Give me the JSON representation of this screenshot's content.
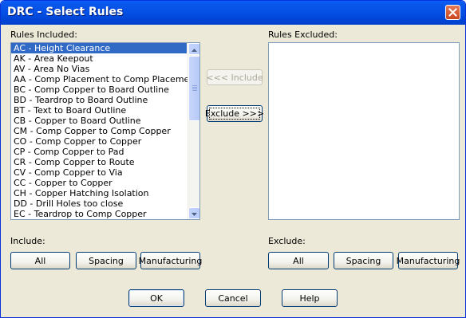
{
  "window": {
    "title": "DRC - Select Rules"
  },
  "included": {
    "label": "Rules Included:",
    "items": [
      "AC - Height Clearance",
      "AK - Area Keepout",
      "AV - Area No Vias",
      "AA - Comp Placement to Comp Placement",
      "BC - Comp Copper to Board Outline",
      "BD - Teardrop to Board Outline",
      "BT - Text to Board Outline",
      "CB - Copper to Board Outline",
      "CM - Comp Copper to Comp Copper",
      "CO - Comp Copper to Copper",
      "CP - Comp Copper to Pad",
      "CR - Comp Copper to Route",
      "CV - Comp Copper to Via",
      "CC - Copper to Copper",
      "CH - Copper Hatching Isolation",
      "DD - Drill Holes too close",
      "EC - Teardrop to Comp Copper"
    ],
    "selected_index": 0
  },
  "excluded": {
    "label": "Rules Excluded:",
    "items": []
  },
  "middle": {
    "include_label": "<<< Include",
    "exclude_label": "Exclude >>>"
  },
  "include_group": {
    "label": "Include:",
    "all": "All",
    "spacing": "Spacing",
    "manufacturing": "Manufacturing"
  },
  "exclude_group": {
    "label": "Exclude:",
    "all": "All",
    "spacing": "Spacing",
    "manufacturing": "Manufacturing"
  },
  "footer": {
    "ok": "OK",
    "cancel": "Cancel",
    "help": "Help"
  },
  "colors": {
    "title_bar": "#0550e6",
    "selection": "#316ac5",
    "dialog_bg": "#ece9d8"
  }
}
